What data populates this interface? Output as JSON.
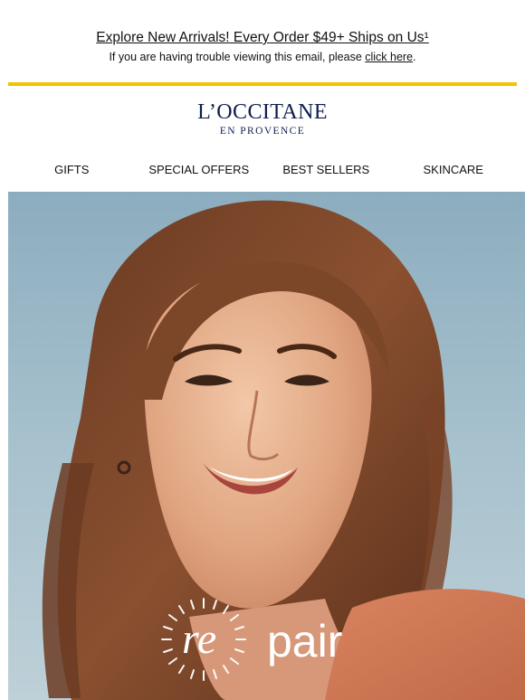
{
  "promo": {
    "headline": "Explore New Arrivals! Every Order $49+ Ships on Us¹",
    "trouble_text": "If you are having trouble viewing this email, please ",
    "trouble_link": "click here",
    "trouble_end": "."
  },
  "brand": {
    "name": "L’OCCITANE",
    "sub": "EN PROVENCE",
    "accent_color": "#f1c400",
    "logo_color": "#0f1f4d"
  },
  "nav": {
    "items": [
      "GIFTS",
      "SPECIAL OFFERS",
      "BEST SELLERS",
      "SKINCARE"
    ]
  },
  "hero": {
    "logo_prefix": "re",
    "logo_suffix": "pair"
  }
}
